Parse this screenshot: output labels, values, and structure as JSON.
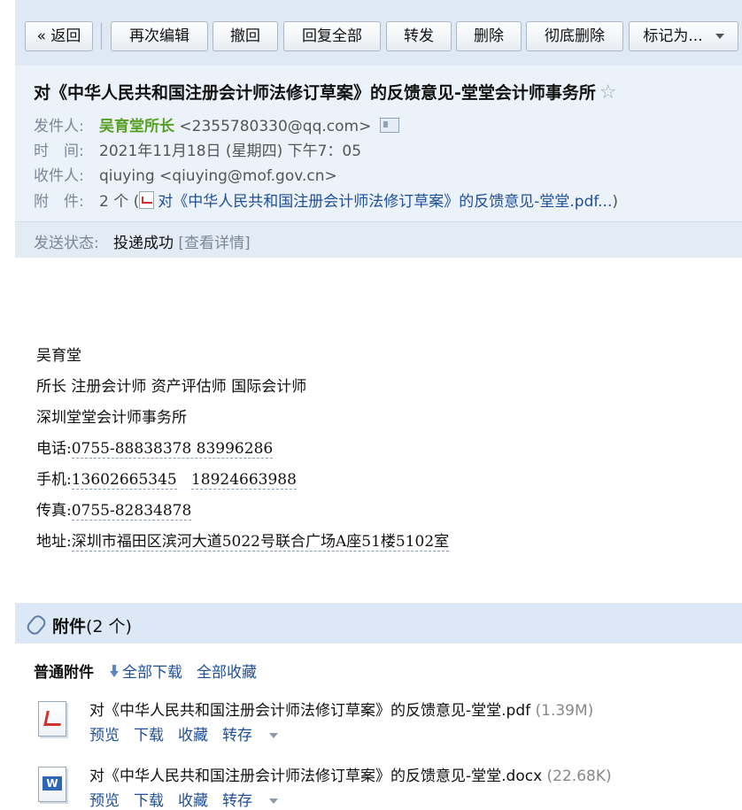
{
  "toolbar": {
    "back": "« 返回",
    "reedit": "再次编辑",
    "recall": "撤回",
    "reply_all": "回复全部",
    "forward": "转发",
    "delete": "删除",
    "delete_permanently": "彻底删除",
    "mark_as": "标记为..."
  },
  "header": {
    "subject": "对《中华人民共和国注册会计师法修订草案》的反馈意见-堂堂会计师事务所",
    "star": "☆",
    "from_label": "发件人:",
    "from_name": "吴育堂所长",
    "from_email": "<2355780330@qq.com>",
    "time_label": "时　间:",
    "time_value": "2021年11月18日 (星期四) 下午7：05",
    "to_label": "收件人:",
    "to_value": "qiuying <qiuying@mof.gov.cn>",
    "att_label": "附　件:",
    "att_count": "2 个 (",
    "att_link": "对《中华人民共和国注册会计师法修订草案》的反馈意见-堂堂.pdf...",
    "att_close": ")",
    "status_label": "发送状态:",
    "status_value": "投递成功",
    "status_detail": "[查看详情]"
  },
  "signature": {
    "name": "吴育堂",
    "title": "所长 注册会计师 资产评估师 国际会计师",
    "company": "深圳堂堂会计师事务所",
    "phone_label": "电话:",
    "phone": "0755-88838378 83996286",
    "mobile_label": "手机:",
    "mobile_1": "13602665345",
    "mobile_2": "18924663988",
    "fax_label": "传真:",
    "fax": "0755-82834878",
    "address_label": "地址:",
    "address": "深圳市福田区滨河大道5022号联合广场A座51楼5102室"
  },
  "attachments": {
    "title": "附件",
    "count": "(2 个)",
    "section_label": "普通附件",
    "download_all": "全部下载",
    "collect_all": "全部收藏",
    "files": [
      {
        "name": "对《中华人民共和国注册会计师法修订草案》的反馈意见-堂堂.pdf",
        "size": "(1.39M)",
        "preview": "预览",
        "download": "下载",
        "collect": "收藏",
        "save": "转存"
      },
      {
        "name": "对《中华人民共和国注册会计师法修订草案》的反馈意见-堂堂.docx",
        "size": "(22.68K)",
        "preview": "预览",
        "download": "下载",
        "collect": "收藏",
        "save": "转存"
      }
    ]
  }
}
